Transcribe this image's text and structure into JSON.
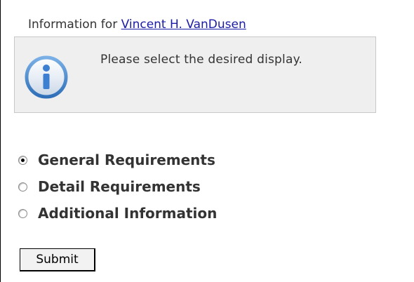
{
  "header": {
    "prefix": "Information for",
    "person_link": "Vincent H. VanDusen"
  },
  "notice": {
    "icon": "info-icon",
    "message": "Please select the desired display."
  },
  "display_options": {
    "selected": "General Requirements",
    "items": [
      {
        "label": "General Requirements",
        "checked": true
      },
      {
        "label": "Detail Requirements",
        "checked": false
      },
      {
        "label": "Additional Information",
        "checked": false
      }
    ]
  },
  "form": {
    "submit_label": "Submit"
  }
}
